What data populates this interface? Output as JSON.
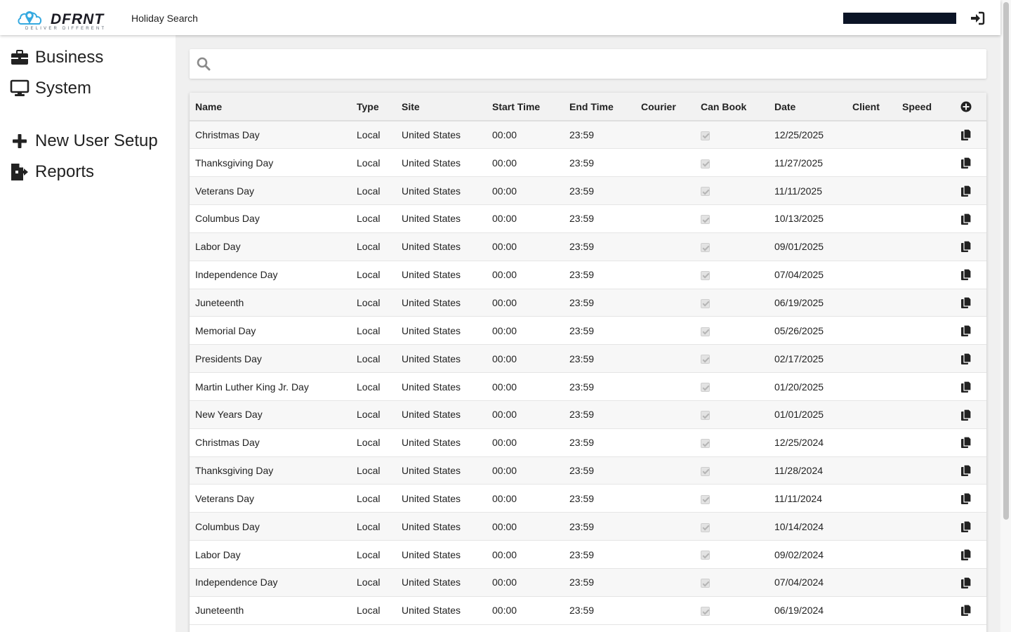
{
  "header": {
    "logo_text": "DFRNT",
    "logo_tagline": "DELIVER DIFFERENT",
    "page_title": "Holiday Search"
  },
  "sidebar": {
    "items": [
      {
        "label": "Business",
        "icon": "briefcase-icon"
      },
      {
        "label": "System",
        "icon": "monitor-icon"
      },
      {
        "label": "New User Setup",
        "icon": "plus-icon"
      },
      {
        "label": "Reports",
        "icon": "file-export-icon"
      }
    ]
  },
  "search": {
    "placeholder": "",
    "value": ""
  },
  "table": {
    "columns": [
      "Name",
      "Type",
      "Site",
      "Start Time",
      "End Time",
      "Courier",
      "Can Book",
      "Date",
      "Client",
      "Speed"
    ],
    "rows": [
      [
        "Christmas Day",
        "Local",
        "United States",
        "00:00",
        "23:59",
        "",
        true,
        "12/25/2025",
        "",
        ""
      ],
      [
        "Thanksgiving Day",
        "Local",
        "United States",
        "00:00",
        "23:59",
        "",
        true,
        "11/27/2025",
        "",
        ""
      ],
      [
        "Veterans Day",
        "Local",
        "United States",
        "00:00",
        "23:59",
        "",
        true,
        "11/11/2025",
        "",
        ""
      ],
      [
        "Columbus Day",
        "Local",
        "United States",
        "00:00",
        "23:59",
        "",
        true,
        "10/13/2025",
        "",
        ""
      ],
      [
        "Labor Day",
        "Local",
        "United States",
        "00:00",
        "23:59",
        "",
        true,
        "09/01/2025",
        "",
        ""
      ],
      [
        "Independence Day",
        "Local",
        "United States",
        "00:00",
        "23:59",
        "",
        true,
        "07/04/2025",
        "",
        ""
      ],
      [
        "Juneteenth",
        "Local",
        "United States",
        "00:00",
        "23:59",
        "",
        true,
        "06/19/2025",
        "",
        ""
      ],
      [
        "Memorial Day",
        "Local",
        "United States",
        "00:00",
        "23:59",
        "",
        true,
        "05/26/2025",
        "",
        ""
      ],
      [
        "Presidents Day",
        "Local",
        "United States",
        "00:00",
        "23:59",
        "",
        true,
        "02/17/2025",
        "",
        ""
      ],
      [
        "Martin Luther King Jr. Day",
        "Local",
        "United States",
        "00:00",
        "23:59",
        "",
        true,
        "01/20/2025",
        "",
        ""
      ],
      [
        "New Years Day",
        "Local",
        "United States",
        "00:00",
        "23:59",
        "",
        true,
        "01/01/2025",
        "",
        ""
      ],
      [
        "Christmas Day",
        "Local",
        "United States",
        "00:00",
        "23:59",
        "",
        true,
        "12/25/2024",
        "",
        ""
      ],
      [
        "Thanksgiving Day",
        "Local",
        "United States",
        "00:00",
        "23:59",
        "",
        true,
        "11/28/2024",
        "",
        ""
      ],
      [
        "Veterans Day",
        "Local",
        "United States",
        "00:00",
        "23:59",
        "",
        true,
        "11/11/2024",
        "",
        ""
      ],
      [
        "Columbus Day",
        "Local",
        "United States",
        "00:00",
        "23:59",
        "",
        true,
        "10/14/2024",
        "",
        ""
      ],
      [
        "Labor Day",
        "Local",
        "United States",
        "00:00",
        "23:59",
        "",
        true,
        "09/02/2024",
        "",
        ""
      ],
      [
        "Independence Day",
        "Local",
        "United States",
        "00:00",
        "23:59",
        "",
        true,
        "07/04/2024",
        "",
        ""
      ],
      [
        "Juneteenth",
        "Local",
        "United States",
        "00:00",
        "23:59",
        "",
        true,
        "06/19/2024",
        "",
        ""
      ]
    ]
  },
  "icons": {
    "search": "search-icon",
    "logout": "sign-in-icon",
    "add": "plus-circle-icon",
    "row_action": "copy-icon"
  },
  "colors": {
    "accent_logo_blue": "#35a9e0",
    "text_dark": "#222222",
    "header_bg": "#f2f2f2",
    "user_bar": "#0b1426"
  }
}
